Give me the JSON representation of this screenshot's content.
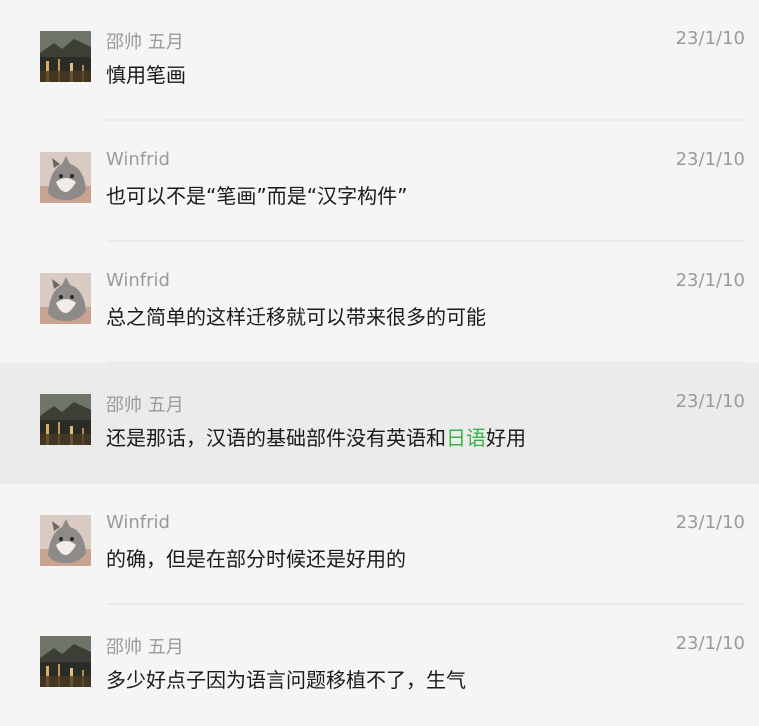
{
  "colors": {
    "background": "#f5f5f5",
    "highlight_background": "#ebebeb",
    "meta_text": "#9a9a9a",
    "body_text": "#1a1a1a",
    "link": "#3bb24a"
  },
  "messages": [
    {
      "sender": "邵帅 五月",
      "avatar": "night-street-photo",
      "date": "23/1/10",
      "text": "慎用笔画"
    },
    {
      "sender": "Winfrid",
      "avatar": "cat-photo",
      "date": "23/1/10",
      "text": "也可以不是“笔画”而是“汉字构件”"
    },
    {
      "sender": "Winfrid",
      "avatar": "cat-photo",
      "date": "23/1/10",
      "text": "总之简单的这样迁移就可以带来很多的可能"
    },
    {
      "sender": "邵帅 五月",
      "avatar": "night-street-photo",
      "date": "23/1/10",
      "text_before": "还是那话，汉语的基础部件没有英语和",
      "link_text": "日语",
      "text_after": "好用",
      "highlighted": true
    },
    {
      "sender": "Winfrid",
      "avatar": "cat-photo",
      "date": "23/1/10",
      "text": "的确，但是在部分时候还是好用的"
    },
    {
      "sender": "邵帅 五月",
      "avatar": "night-street-photo",
      "date": "23/1/10",
      "text": "多少好点子因为语言问题移植不了，生气"
    }
  ]
}
